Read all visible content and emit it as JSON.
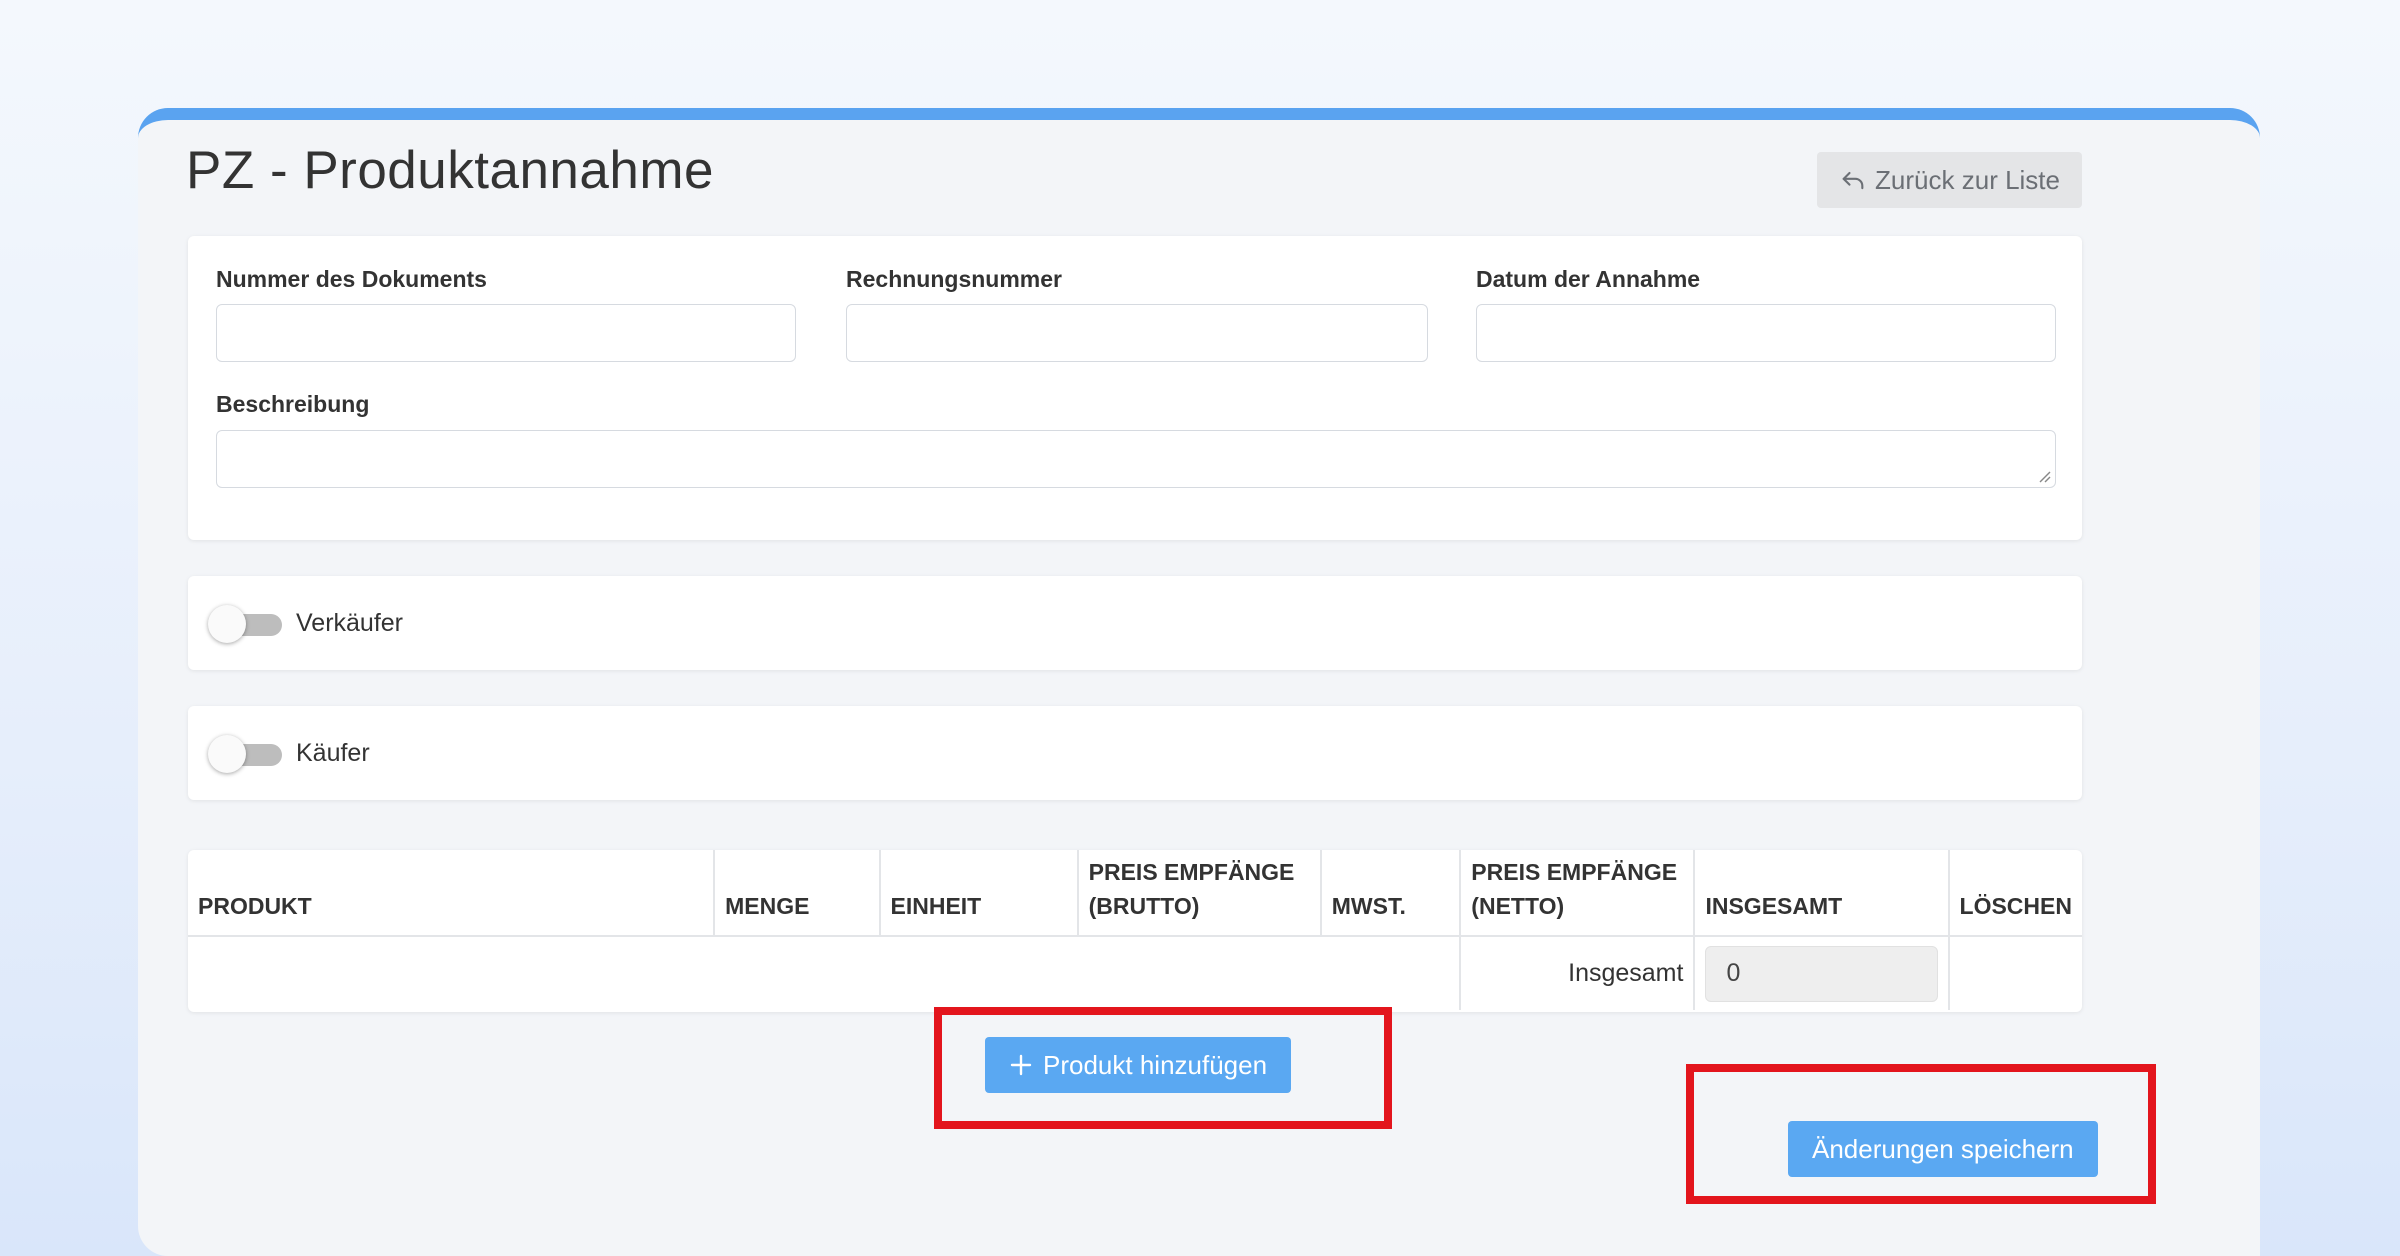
{
  "page": {
    "title": "PZ - Produktannahme",
    "back_label": "Zurück zur Liste"
  },
  "form": {
    "document_number": {
      "label": "Nummer des Dokuments",
      "value": ""
    },
    "invoice_number": {
      "label": "Rechnungsnummer",
      "value": ""
    },
    "acceptance_date": {
      "label": "Datum der Annahme",
      "value": ""
    },
    "description": {
      "label": "Beschreibung",
      "value": ""
    }
  },
  "toggles": {
    "seller": {
      "label": "Verkäufer",
      "on": false
    },
    "buyer": {
      "label": "Käufer",
      "on": false
    }
  },
  "table": {
    "headers": {
      "product": "PRODUKT",
      "quantity": "MENGE",
      "unit": "EINHEIT",
      "price_gross_1": "PREIS EMPFÄNGE",
      "price_gross_2": "(BRUTTO)",
      "vat": "MWST.",
      "price_net_1": "PREIS EMPFÄNGE",
      "price_net_2": "(NETTO)",
      "total": "INSGESAMT",
      "delete": "LÖSCHEN"
    },
    "sum_label": "Insgesamt",
    "sum_value": "0"
  },
  "actions": {
    "add_product": "Produkt hinzufügen",
    "save_changes": "Änderungen speichern"
  },
  "colors": {
    "accent": "#5aa8f2",
    "highlight": "#e3151d"
  }
}
